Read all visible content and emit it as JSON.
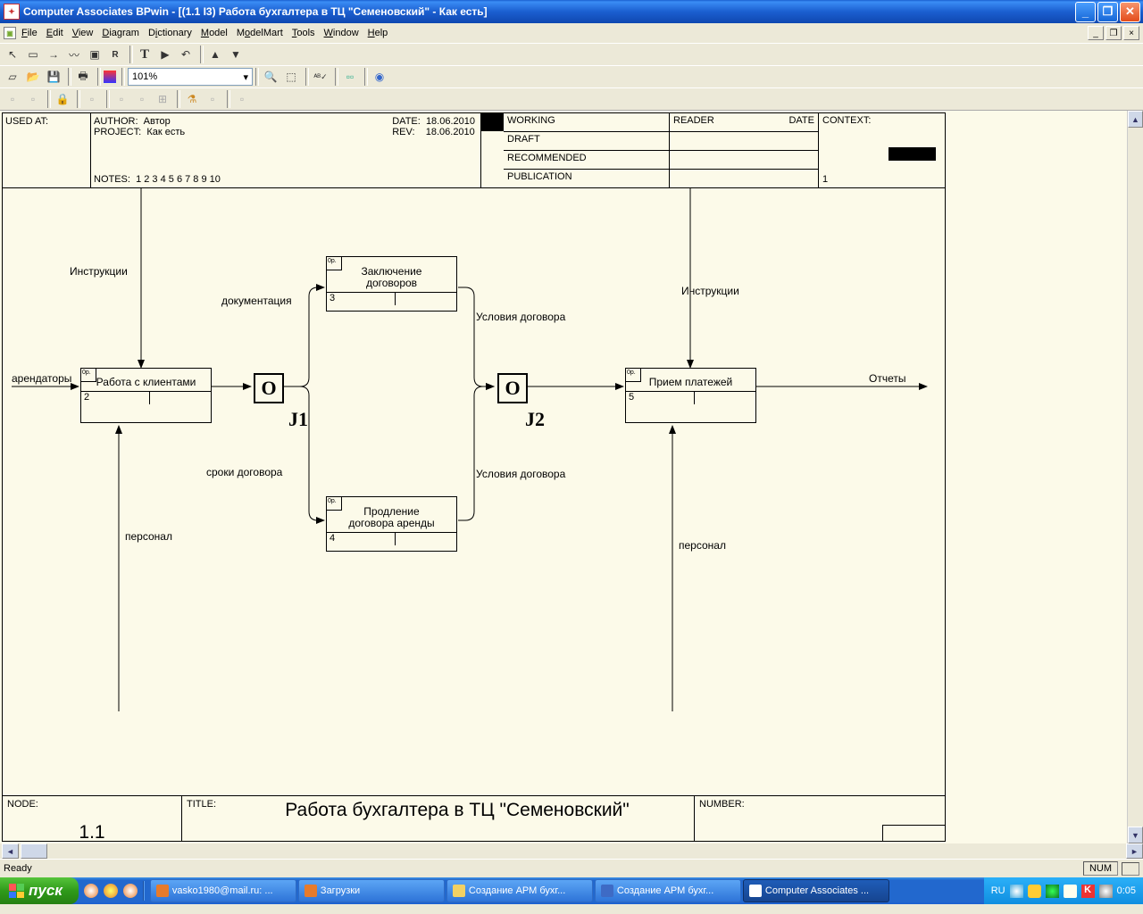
{
  "title": "Computer Associates BPwin - [(1.1 I3) Работа бухгалтера в ТЦ \"Семеновский\" - Как есть]",
  "menu": [
    "File",
    "Edit",
    "View",
    "Diagram",
    "Dictionary",
    "Model",
    "ModelMart",
    "Tools",
    "Window",
    "Help"
  ],
  "zoom": "101%",
  "header": {
    "used_at": "USED AT:",
    "author_lbl": "AUTHOR:",
    "author": "Автор",
    "project_lbl": "PROJECT:",
    "project": "Как есть",
    "date_lbl": "DATE:",
    "date": "18.06.2010",
    "rev_lbl": "REV:",
    "rev": "18.06.2010",
    "notes_lbl": "NOTES:",
    "notes": "1  2  3  4  5  6  7  8  9  10",
    "working": "WORKING",
    "draft": "DRAFT",
    "recommended": "RECOMMENDED",
    "publication": "PUBLICATION",
    "reader": "READER",
    "reader_date": "DATE",
    "context": "CONTEXT:",
    "context_num": "1"
  },
  "footer": {
    "node_lbl": "NODE:",
    "node": "1.1",
    "title_lbl": "TITLE:",
    "title": "Работа бухгалтера в ТЦ \"Семеновский\"",
    "number_lbl": "NUMBER:"
  },
  "boxes": {
    "b2": {
      "name": "Работа с клиентами",
      "num": "2",
      "corner": "0р."
    },
    "b3": {
      "name_l1": "Заключение",
      "name_l2": "договоров",
      "num": "3",
      "corner": "0р."
    },
    "b4": {
      "name_l1": "Продление",
      "name_l2": "договора аренды",
      "num": "4",
      "corner": "0р."
    },
    "b5": {
      "name": "Прием платежей",
      "num": "5",
      "corner": "0р."
    }
  },
  "junctions": {
    "j1_sym": "O",
    "j1_lbl": "J1",
    "j2_sym": "O",
    "j2_lbl": "J2"
  },
  "arrows": {
    "arendatory": "арендаторы",
    "instrukcii": "Инструкции",
    "personal": "персонал",
    "dokumentaciya": "документация",
    "sroki": "сроки договора",
    "usloviya": "Условия договора",
    "instrukcii2": "Инструкции",
    "personal2": "персонал",
    "otchety": "Отчеты"
  },
  "status": "Ready",
  "status_num": "NUM",
  "start": "пуск",
  "tasks": [
    {
      "label": "vasko1980@mail.ru: ...",
      "icon": "#e77b2b"
    },
    {
      "label": "Загрузки",
      "icon": "#e77b2b"
    },
    {
      "label": "Создание АРМ бухг...",
      "icon": "#f3d163"
    },
    {
      "label": "Создание АРМ бухг...",
      "icon": "#3e6bc5"
    },
    {
      "label": "Computer Associates ...",
      "icon": "#fff",
      "active": true
    }
  ],
  "tray": {
    "lang": "RU",
    "time": "0:05"
  }
}
